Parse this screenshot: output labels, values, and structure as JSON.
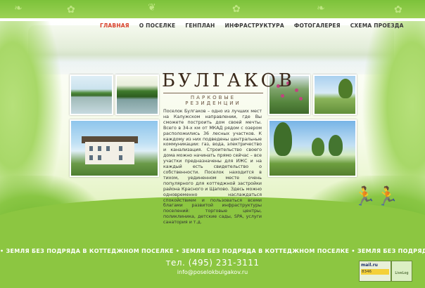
{
  "nav": {
    "items": [
      {
        "label": "ГЛАВНАЯ",
        "active": true
      },
      {
        "label": "О ПОСЕЛКЕ",
        "active": false
      },
      {
        "label": "ГЕНПЛАН",
        "active": false
      },
      {
        "label": "ИНФРАСТРУКТУРА",
        "active": false
      },
      {
        "label": "ФОТОГАЛЕРЕЯ",
        "active": false
      },
      {
        "label": "СХЕМА ПРОЕЗДА",
        "active": false
      }
    ]
  },
  "logo": {
    "name": "БУЛГАКОВ",
    "subtitle": "ПАРКОВЫЕ РЕЗИДЕНЦИИ"
  },
  "description": "Поселок Булгаков – одно из лучших мест на Калужском направлении, где Вы сможете построить дом своей мечты. Всего в 34-х км от МКАД рядом с озером расположились 36 лесных участков. К каждому из них подведены центральные коммуникации: газ, вода, электричество и канализация. Строительство своего дома можно начинать прямо сейчас – все участки предназначены для ИЖС и на каждый есть свидетельство о собственности. Поселок находится в тихом, уединенном месте очень популярного для коттеджной застройки района Красного и Щапово. Здесь можно одновременно наслаждаться спокойствием и пользоваться всеми благами развитой инфраструктуры поселений: торговые центры, поликлиника, детские сады, SPA, услуги санатория и т.д.",
  "strip_text": "• ЗЕМЛЯ БЕЗ ПОДРЯДА В КОТТЕДЖНОМ ПОСЕЛКЕ • ЗЕМЛЯ БЕЗ ПОДРЯДА В КОТТЕДЖНОМ ПОСЕЛКЕ • ЗЕМЛЯ БЕЗ ПОДРЯДА В КОТТЕДЖНОМ ПОСЕЛКЕ •",
  "contact": {
    "phone": "тел. (495) 231-3111",
    "email": "info@poselokbulgakov.ru"
  },
  "counters": {
    "mail_label": "mail.ru",
    "mail_count": "8346",
    "liveinternet_label": "LiveLog"
  },
  "colors": {
    "accent_active": "#d8402a",
    "background_green": "#8cc641"
  }
}
